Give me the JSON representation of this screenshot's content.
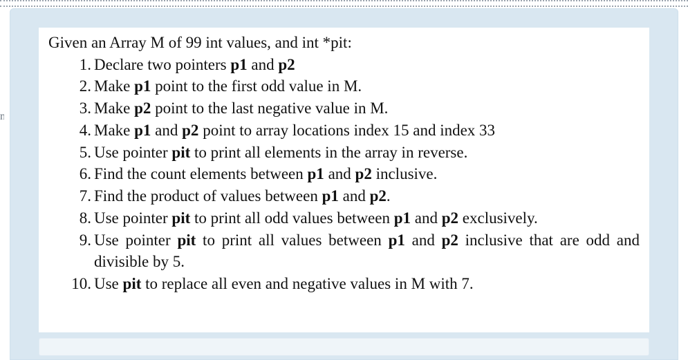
{
  "doc": {
    "intro_prefix": "Given an Array M of 99 int values, and int ",
    "intro_ptr": "*pit",
    "intro_suffix": ":",
    "items": [
      {
        "parts": [
          {
            "t": "Declare two pointers "
          },
          {
            "t": "p1",
            "b": true
          },
          {
            "t": " and "
          },
          {
            "t": "p2",
            "b": true
          }
        ]
      },
      {
        "parts": [
          {
            "t": "Make "
          },
          {
            "t": "p1",
            "b": true
          },
          {
            "t": " point to the first odd value in M."
          }
        ]
      },
      {
        "parts": [
          {
            "t": "Make "
          },
          {
            "t": "p2",
            "b": true
          },
          {
            "t": " point to the last negative value in M."
          }
        ]
      },
      {
        "parts": [
          {
            "t": "Make "
          },
          {
            "t": "p1",
            "b": true
          },
          {
            "t": " and "
          },
          {
            "t": "p2",
            "b": true
          },
          {
            "t": " point to array locations index 15 and index 33"
          }
        ]
      },
      {
        "parts": [
          {
            "t": "Use pointer "
          },
          {
            "t": "pit",
            "b": true
          },
          {
            "t": " to print all elements in the array in reverse."
          }
        ]
      },
      {
        "parts": [
          {
            "t": "Find the count elements between "
          },
          {
            "t": "p1",
            "b": true
          },
          {
            "t": " and "
          },
          {
            "t": "p2",
            "b": true
          },
          {
            "t": " inclusive."
          }
        ]
      },
      {
        "parts": [
          {
            "t": "Find the product of values between "
          },
          {
            "t": "p1",
            "b": true
          },
          {
            "t": " and "
          },
          {
            "t": "p2",
            "b": true
          },
          {
            "t": "."
          }
        ]
      },
      {
        "justify": true,
        "parts": [
          {
            "t": "Use pointer "
          },
          {
            "t": "pit",
            "b": true
          },
          {
            "t": " to print all odd values between "
          },
          {
            "t": "p1",
            "b": true
          },
          {
            "t": " and "
          },
          {
            "t": "p2",
            "b": true
          },
          {
            "t": " exclusively."
          }
        ]
      },
      {
        "justify": true,
        "parts": [
          {
            "t": "Use pointer "
          },
          {
            "t": "pit",
            "b": true
          },
          {
            "t": " to print all values between "
          },
          {
            "t": "p1",
            "b": true
          },
          {
            "t": " and "
          },
          {
            "t": "p2",
            "b": true
          },
          {
            "t": " inclusive that are odd and divisible by 5."
          }
        ]
      },
      {
        "parts": [
          {
            "t": "Use "
          },
          {
            "t": "pit",
            "b": true
          },
          {
            "t": " to replace all even and negative values in M with 7."
          }
        ]
      }
    ]
  },
  "sliver": "n"
}
